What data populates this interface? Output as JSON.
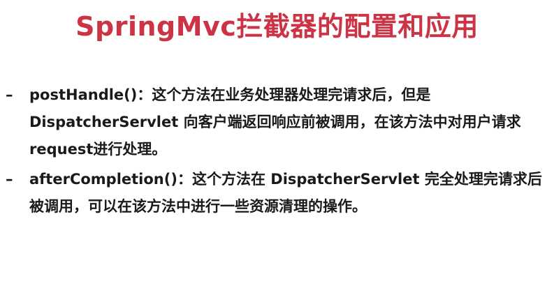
{
  "slide": {
    "title": "SpringMvc拦截器的配置和应用",
    "colors": {
      "title": "#cc3344",
      "text": "#1a1a1a",
      "background": "#ffffff"
    },
    "bullets": [
      {
        "marker": "–",
        "text": "postHandle()：这个方法在业务处理器处理完请求后，但是 DispatcherServlet 向客户端返回响应前被调用，在该方法中对用户请求request进行处理。"
      },
      {
        "marker": "–",
        "text": "afterCompletion()：这个方法在 DispatcherServlet 完全处理完请求后被调用，可以在该方法中进行一些资源清理的操作。"
      }
    ]
  }
}
